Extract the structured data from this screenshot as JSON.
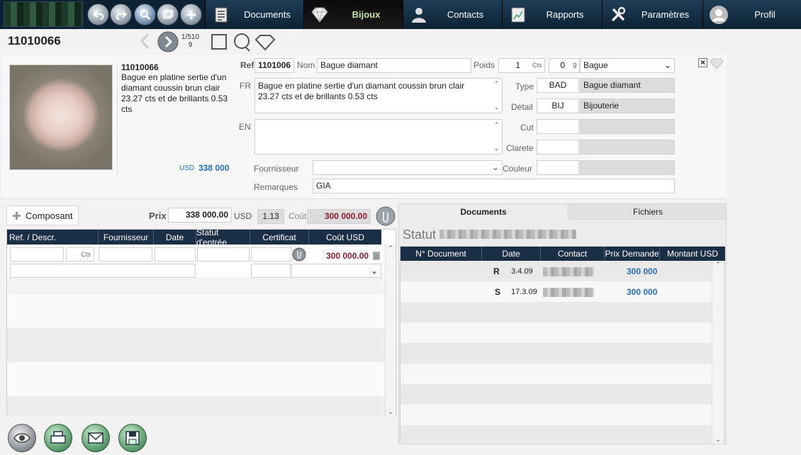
{
  "nav": {
    "tabs": [
      {
        "label": "Documents",
        "icon": "document-icon"
      },
      {
        "label": "Bijoux",
        "icon": "diamond-icon",
        "active": true
      },
      {
        "label": "Contacts",
        "icon": "person-icon"
      },
      {
        "label": "Rapports",
        "icon": "report-icon"
      },
      {
        "label": "Paramètres",
        "icon": "tools-icon"
      },
      {
        "label": "Profil",
        "icon": "avatar-icon"
      }
    ],
    "toolbar_icons": [
      "undo-icon",
      "redo-icon",
      "search-icon",
      "windows-icon",
      "add-icon"
    ]
  },
  "record": {
    "id": "11010066",
    "page_index": "1/510",
    "page_sub": "9"
  },
  "item": {
    "id": "11010066",
    "description": "Bague en platine sertie d'un diamant coussin brun clair 23.27 cts et de brillants 0.53 cts",
    "currency": "USD",
    "price": "338 000"
  },
  "form": {
    "ref_label": "Ref",
    "ref_value": "1101006",
    "nom_label": "Nom",
    "nom_value": "Bague diamant",
    "poids_label": "Poids",
    "poids_cts_value": "1",
    "poids_cts_unit": "Cts",
    "poids_g_value": "0",
    "poids_g_unit": "g",
    "category_value": "Bague",
    "fr_label": "FR",
    "fr_text": "Bague en platine sertie d'un diamant coussin brun clair 23.27 cts et de brillants 0.53 cts",
    "en_label": "EN",
    "en_text": "",
    "type_label": "Type",
    "type_code": "BAD",
    "type_name": "Bague diamant",
    "detail_label": "Détail",
    "detail_code": "BIJ",
    "detail_name": "Bijouterie",
    "cut_label": "Cut",
    "clarete_label": "Clarete",
    "couleur_label": "Couleur",
    "fournisseur_label": "Fournisseur",
    "remarques_label": "Remarques",
    "remarques_value": "GIA",
    "close_symbol": "×"
  },
  "components": {
    "add_label": "Composant",
    "prix_label": "Prix",
    "prix_value": "338 000.00",
    "prix_currency": "USD",
    "ratio": "1.13",
    "cout_label": "Coût",
    "cout_value": "300 000.00",
    "columns": [
      "Ref. / Descr.",
      "Fournisseur",
      "Date",
      "Statut d'entrée",
      "Certificat",
      "Coût USD"
    ],
    "row": {
      "cts_unit": "Cts",
      "cout": "300 000.00"
    }
  },
  "right_panel": {
    "tabs": [
      {
        "label": "Documents",
        "active": true
      },
      {
        "label": "Fichiers",
        "active": false
      }
    ],
    "statut_label": "Statut",
    "columns": [
      "N° Document",
      "Date",
      "Contact",
      "Prix Demande",
      "Montant USD"
    ],
    "rows": [
      {
        "code": "R",
        "date": "3.4.09",
        "prix": "300 000"
      },
      {
        "code": "S",
        "date": "17.3.09",
        "prix": "300 000"
      }
    ]
  },
  "bottom_actions": [
    "eye-icon",
    "printer-icon",
    "mail-icon",
    "save-icon"
  ]
}
